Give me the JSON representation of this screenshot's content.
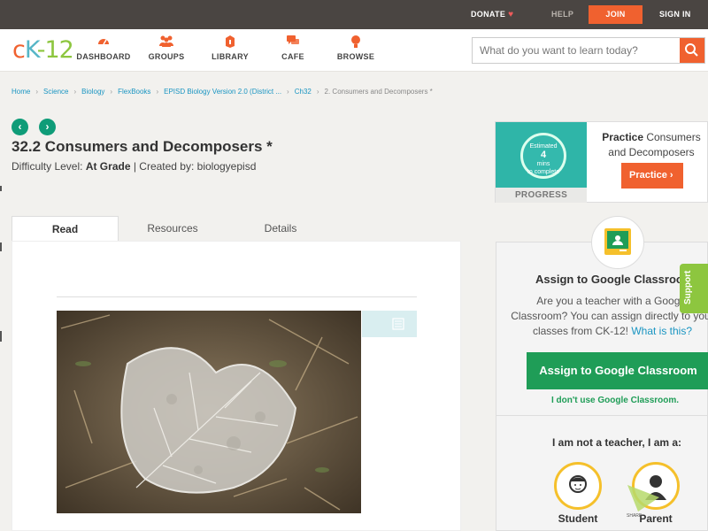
{
  "topbar": {
    "donate": "DONATE",
    "help": "HELP",
    "join": "JOIN",
    "signin": "SIGN IN"
  },
  "header": {
    "logo": {
      "c": "c",
      "k": "K",
      "dash": "-",
      "n": "12"
    },
    "nav": [
      {
        "label": "DASHBOARD",
        "icon": "dashboard-icon"
      },
      {
        "label": "GROUPS",
        "icon": "groups-icon"
      },
      {
        "label": "LIBRARY",
        "icon": "library-icon"
      },
      {
        "label": "CAFE",
        "icon": "cafe-icon"
      },
      {
        "label": "BROWSE",
        "icon": "browse-icon"
      }
    ],
    "search_placeholder": "What do you want to learn today?"
  },
  "breadcrumb": {
    "items": [
      "Home",
      "Science",
      "Biology",
      "FlexBooks",
      "EPISD Biology Version 2.0 (District ...",
      "Ch32"
    ],
    "current": "2. Consumers and Decomposers *"
  },
  "page": {
    "title": "32.2 Consumers and Decomposers *",
    "difficulty_label": "Difficulty Level: ",
    "difficulty_value": "At Grade",
    "created_by": " | Created by: biologyepisd"
  },
  "tabs": [
    "Read",
    "Resources",
    "Details"
  ],
  "practice": {
    "estimated": "Estimated",
    "mins_number": "4",
    "mins_label": "mins",
    "to_complete": "to complete",
    "progress": "PROGRESS",
    "title_bold": "Practice",
    "title_rest": " Consumers and Decomposers",
    "button": "Practice"
  },
  "classroom": {
    "title": "Assign to Google Classroom",
    "desc": "Are you a teacher with a Google Classroom? You can assign directly to your classes from CK-12! ",
    "what_link": "What is this?",
    "button": "Assign to Google Classroom",
    "no_use": "I don't use Google Classroom.",
    "not_teacher": "I am not a teacher, I am a:",
    "roles": [
      "Student",
      "Parent"
    ]
  },
  "support": "Support",
  "sharethis": "SHARE",
  "colors": {
    "accent": "#f0612f",
    "teal": "#0f9c78",
    "green": "#1f9d57",
    "link": "#1a95c2",
    "support": "#8dc63f",
    "topbar": "#4a4542"
  }
}
